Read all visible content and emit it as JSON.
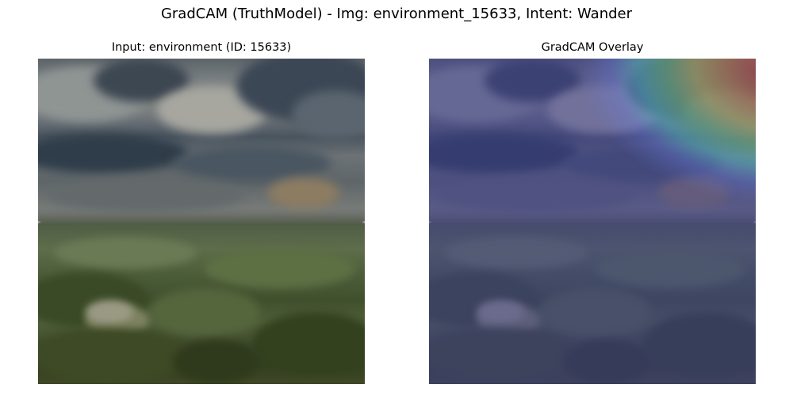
{
  "figure": {
    "suptitle": "GradCAM (TruthModel) - Img: environment_15633, Intent: Wander"
  },
  "panels": [
    {
      "title": "Input: environment (ID: 15633)"
    },
    {
      "title": "GradCAM Overlay"
    }
  ],
  "colors": {
    "background": "#ffffff",
    "overlay_tint": "#3c3c96",
    "heat_high": "#c83228",
    "heat_mid": "#dcd750",
    "heat_low": "#5adcc8"
  }
}
